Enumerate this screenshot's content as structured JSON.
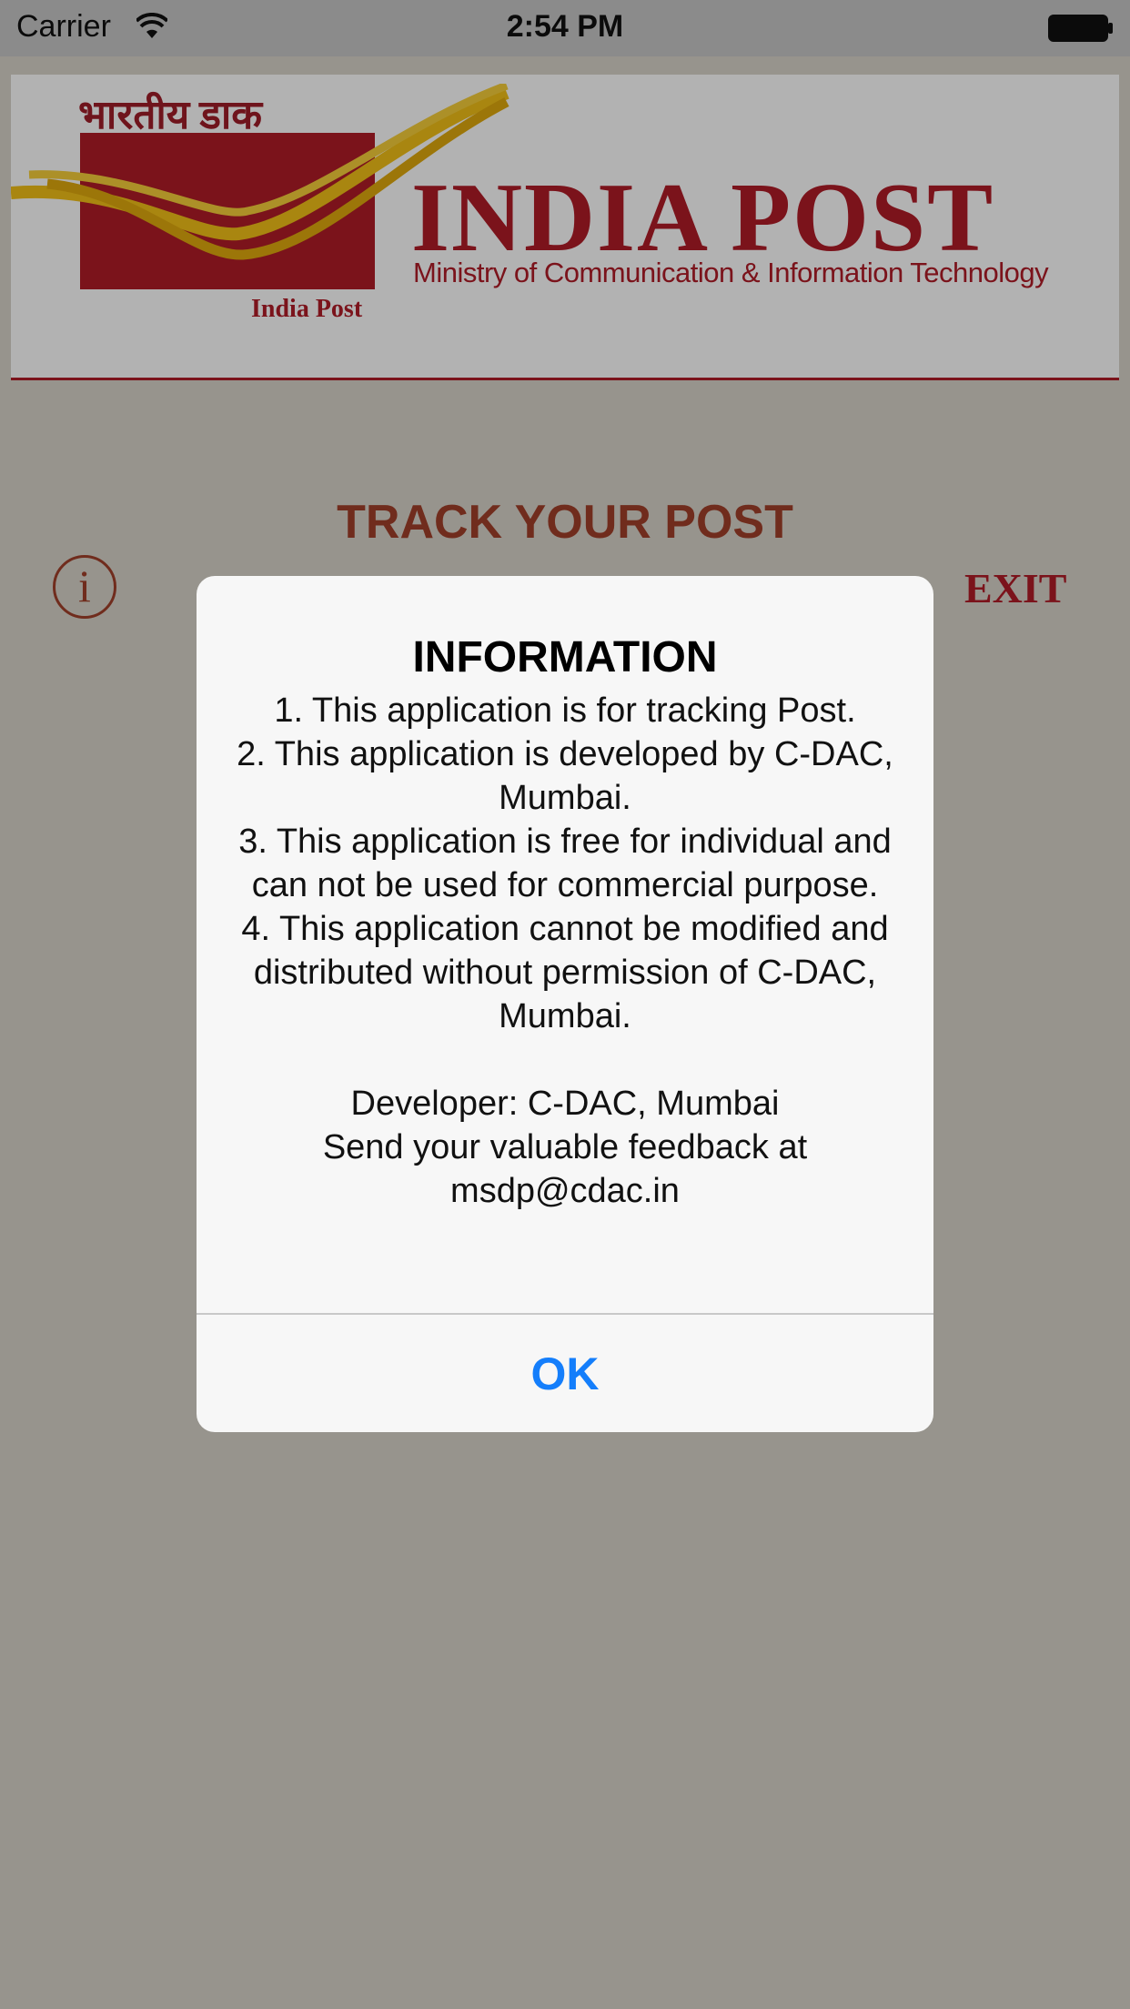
{
  "status_bar": {
    "carrier": "Carrier",
    "time": "2:54 PM"
  },
  "header": {
    "hindi_text": "भारतीय डाक",
    "caption": "India Post",
    "brand": "INDIA POST",
    "tagline": "Ministry of Communication & Information Technology"
  },
  "main": {
    "title": "TRACK YOUR POST",
    "info_glyph": "i",
    "exit_label": "EXIT"
  },
  "alert": {
    "title": "INFORMATION",
    "lines": [
      "1. This application is for tracking Post.",
      "2. This application is developed by C-DAC, Mumbai.",
      "3. This application is free for individual and can not be used for commercial purpose.",
      "4. This application cannot be modified and distributed without permission of C-DAC, Mumbai."
    ],
    "developer": "Developer: C-DAC, Mumbai",
    "feedback": "Send your valuable feedback at",
    "email": "msdp@cdac.in",
    "ok_label": "OK"
  },
  "colors": {
    "brand_red": "#b01c28",
    "accent_brown": "#a1402a",
    "ios_blue": "#147efb",
    "logo_yellow": "#f2c018"
  }
}
